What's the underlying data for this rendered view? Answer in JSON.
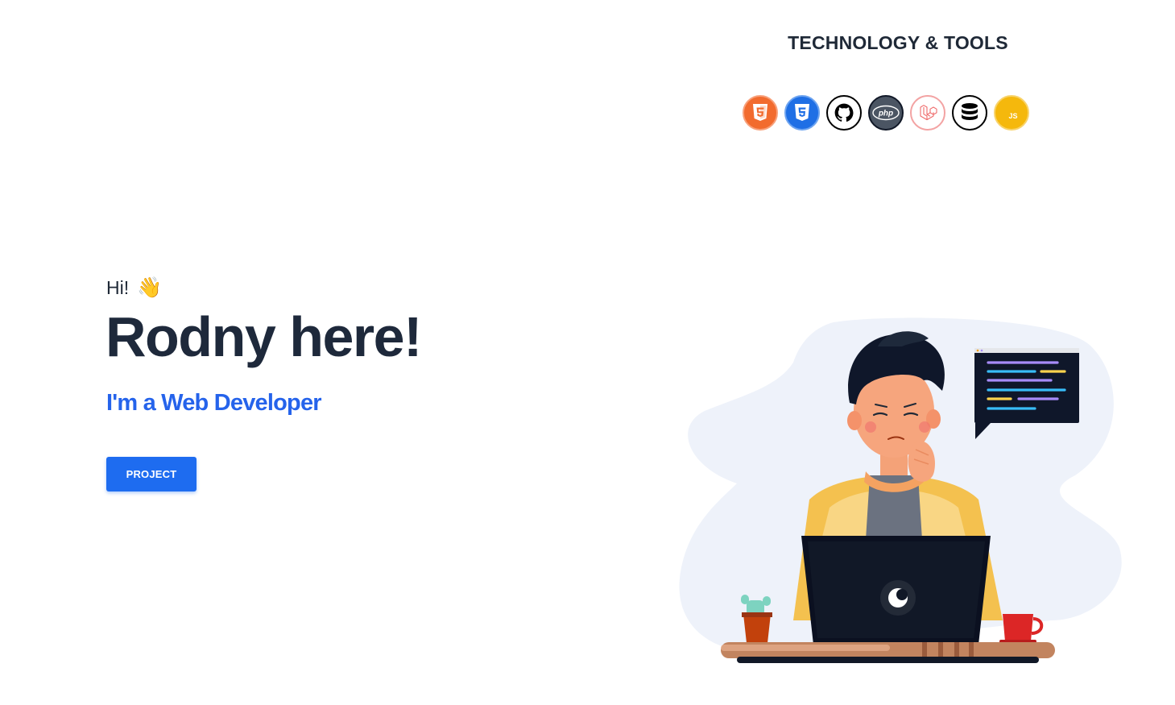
{
  "tools": {
    "title": "TECHNOLOGY & TOOLS",
    "items": [
      {
        "name": "HTML5",
        "icon": "html5-icon",
        "color": "#f26b2e"
      },
      {
        "name": "CSS3",
        "icon": "css3-icon",
        "color": "#1f6fe5"
      },
      {
        "name": "GitHub",
        "icon": "github-icon",
        "color": "#000000"
      },
      {
        "name": "PHP",
        "icon": "php-icon",
        "color": "#4b5563"
      },
      {
        "name": "Laravel",
        "icon": "laravel-icon",
        "color": "#ef6b6b"
      },
      {
        "name": "Database",
        "icon": "database-icon",
        "color": "#000000"
      },
      {
        "name": "JavaScript",
        "icon": "javascript-icon",
        "color": "#f0b400"
      }
    ],
    "php_label": "php",
    "js_label": "JS"
  },
  "hero": {
    "greeting": "Hi!",
    "wave": "👋",
    "headline": "Rodny here!",
    "role": "I'm a Web Developer",
    "button_label": "PROJECT"
  },
  "colors": {
    "accent": "#2563eb",
    "heading": "#1e293b",
    "button": "#1e6cf0"
  }
}
